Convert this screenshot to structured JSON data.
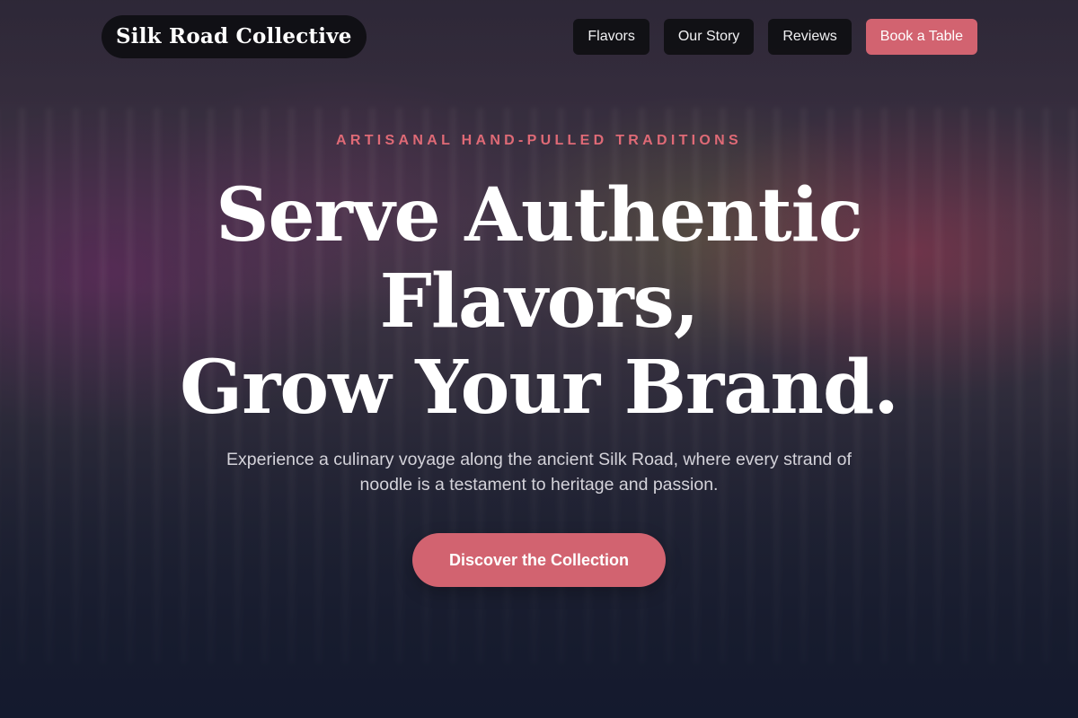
{
  "header": {
    "logo": "Silk Road Collective",
    "nav": [
      {
        "label": "Flavors"
      },
      {
        "label": "Our Story"
      },
      {
        "label": "Reviews"
      },
      {
        "label": "Book a Table"
      }
    ]
  },
  "hero": {
    "eyebrow": "ARTISANAL HAND-PULLED TRADITIONS",
    "headline": {
      "line1": "Serve Authentic",
      "line2": "Flavors,",
      "line3": "Grow Your Brand."
    },
    "subtitle": "Experience a culinary voyage along the ancient Silk Road, where every strand of noodle is a testament to heritage and passion.",
    "cta_label": "Discover the Collection"
  },
  "colors": {
    "accent": "#d26370",
    "eyebrow": "#df6a76",
    "nav_bg": "#0e0e12",
    "headline": "#ffffff"
  }
}
